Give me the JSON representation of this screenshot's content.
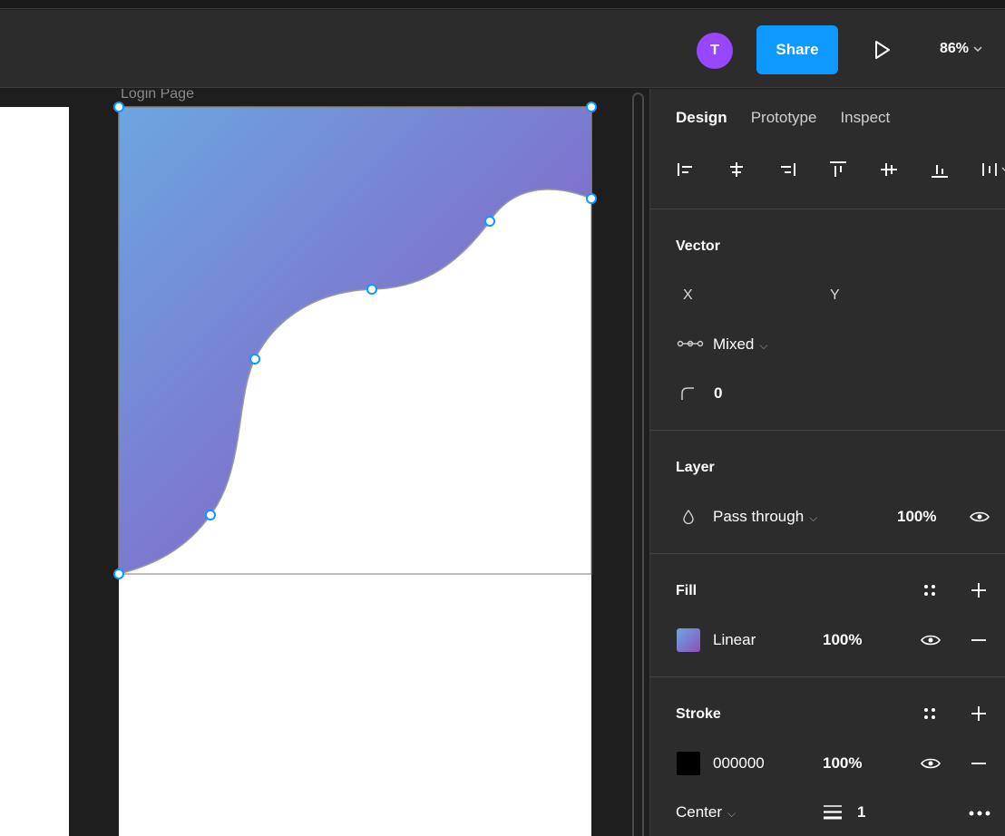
{
  "toolbar": {
    "avatar_initial": "T",
    "share_label": "Share",
    "zoom_label": "86%"
  },
  "canvas": {
    "frame_label": "Login Page",
    "gradient": {
      "start": "#6ca6e0",
      "end": "#8b4fbf"
    }
  },
  "panel": {
    "tabs": [
      {
        "label": "Design",
        "active": true
      },
      {
        "label": "Prototype",
        "active": false
      },
      {
        "label": "Inspect",
        "active": false
      }
    ],
    "vector": {
      "title": "Vector",
      "x_label": "X",
      "y_label": "Y",
      "constraint_value": "Mixed",
      "corner_radius": "0"
    },
    "layer": {
      "title": "Layer",
      "blend_mode": "Pass through",
      "opacity": "100%"
    },
    "fill": {
      "title": "Fill",
      "type": "Linear",
      "opacity": "100%"
    },
    "stroke": {
      "title": "Stroke",
      "color_hex": "000000",
      "opacity": "100%",
      "position": "Center",
      "weight": "1"
    }
  },
  "colors": {
    "accent": "#0d99ff",
    "avatar": "#9747ff",
    "panel_bg": "#2c2c2c",
    "canvas_bg": "#1e1e1e"
  }
}
